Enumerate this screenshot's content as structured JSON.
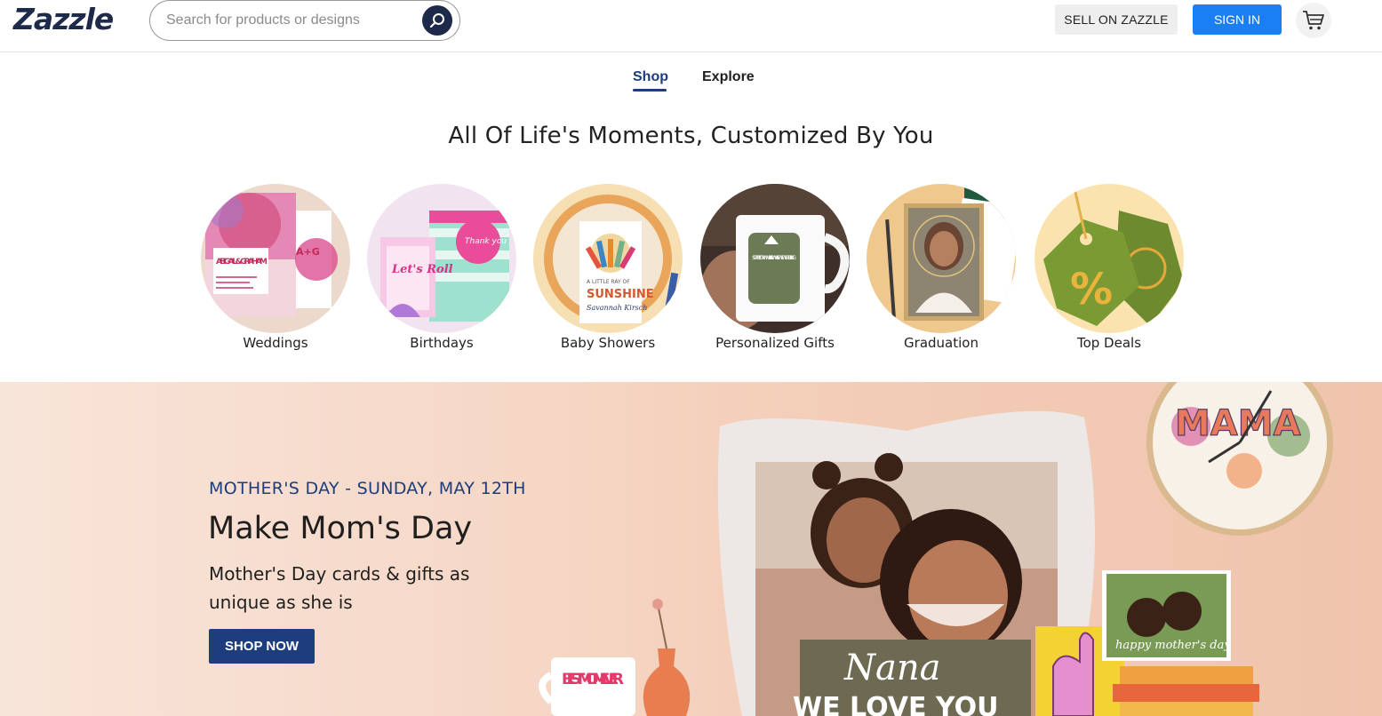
{
  "header": {
    "logo": "Zazzle",
    "search_placeholder": "Search for products or designs",
    "sell_label": "SELL ON ZAZZLE",
    "signin_label": "SIGN IN"
  },
  "tabs": [
    {
      "label": "Shop",
      "active": true
    },
    {
      "label": "Explore",
      "active": false
    }
  ],
  "heading": "All Of Life's Moments, Customized By You",
  "categories": [
    {
      "label": "Weddings",
      "icon": "wedding-invitation-image"
    },
    {
      "label": "Birthdays",
      "icon": "birthday-cards-image"
    },
    {
      "label": "Baby Showers",
      "icon": "baby-shower-invite-image"
    },
    {
      "label": "Personalized Gifts",
      "icon": "mug-image"
    },
    {
      "label": "Graduation",
      "icon": "graduation-card-image"
    },
    {
      "label": "Top Deals",
      "icon": "price-tag-image"
    }
  ],
  "category_art": {
    "wedding_names": "ABIGAIL & GRAHAM",
    "wedding_monogram": "A+G",
    "birthday_card": "Let's Roll",
    "birthday_bag": "Thank you",
    "baby_card_top": "A LITTLE RAY OF",
    "baby_card_word": "SUNSHINE",
    "baby_card_name": "Savannah Kirsch",
    "mug_text": "SORRY FOR WHAT I SAID WHILE WE WERE HIKING",
    "deals_symbol": "%"
  },
  "hero": {
    "eyebrow": "MOTHER'S DAY - SUNDAY, MAY 12TH",
    "title": "Make Mom's Day",
    "subtitle": "Mother's Day cards & gifts as unique as she is",
    "cta": "SHOP NOW",
    "pillow_script": "Nana",
    "pillow_text": "WE LOVE YOU",
    "clock_text": "MAMA",
    "mug_text": "BEST MOM EVER",
    "frame_text": "happy mother's day"
  },
  "colors": {
    "brand_navy": "#1d2a4a",
    "accent_blue": "#1a7ff5",
    "hero_navy": "#1e3d7d",
    "hero_bg": "#f6d8c8"
  }
}
